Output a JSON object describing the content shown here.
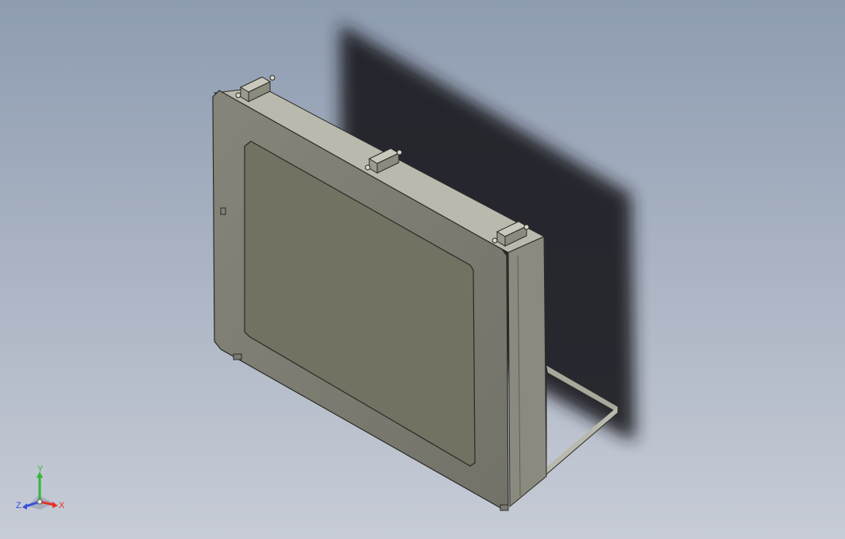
{
  "viewport": {
    "background_top": "#8e9cb1",
    "background_bottom": "#c7ccd6"
  },
  "model": {
    "bezel_color": "#7a7a6c",
    "screen_color": "#727262",
    "side_color": "#8a8b7e",
    "top_color": "#b9b9ad",
    "shadow_color": "#1c1d20",
    "edge_color": "#2b2b27",
    "clip_color": "#9a9a8e"
  },
  "triad": {
    "x_label": "X",
    "y_label": "Y",
    "z_label": "Z",
    "x_color": "#e8322a",
    "y_color": "#31b83a",
    "z_color": "#3850e0"
  }
}
